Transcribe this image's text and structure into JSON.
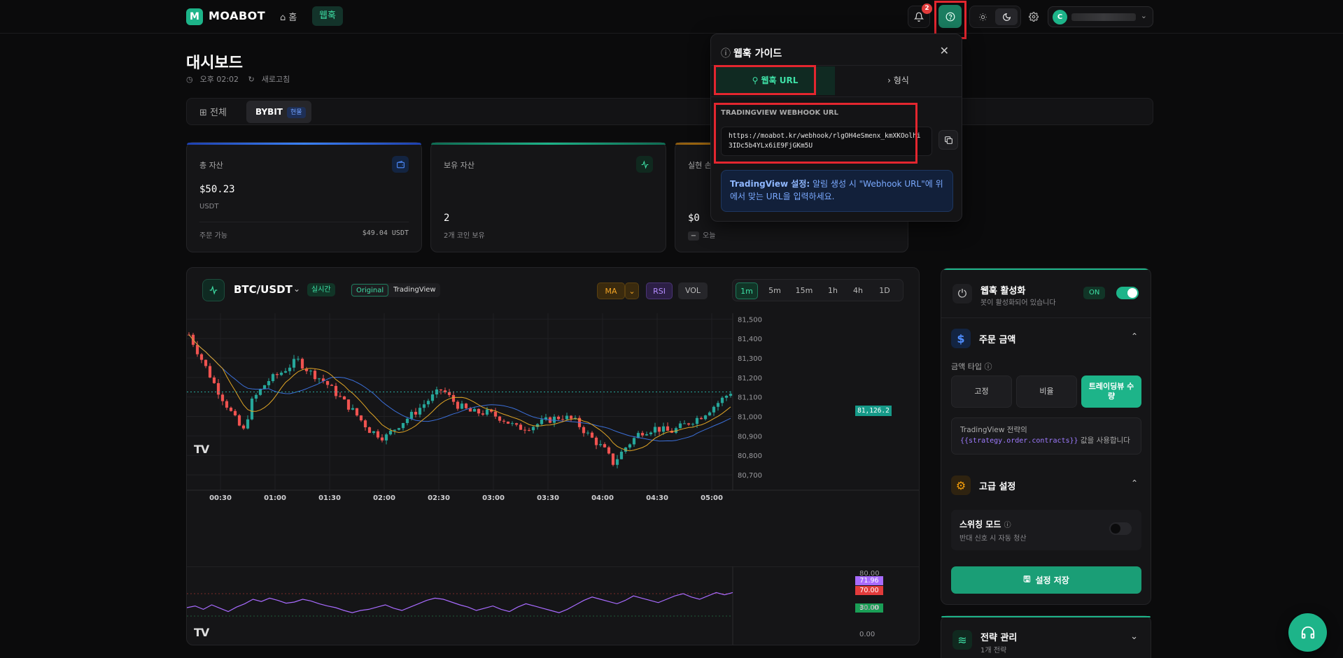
{
  "topbar": {
    "logo_letter": "M",
    "app_name": "MOABOT",
    "nav": [
      {
        "label": "홈",
        "icon": "home-icon"
      },
      {
        "label": "웹훅"
      }
    ],
    "notification_count": "2",
    "avatar_letter": "C"
  },
  "page": {
    "title": "대시보드",
    "time": "오후 02:02",
    "refresh_label": "새로고침"
  },
  "exchange_tabs": {
    "all_label": "전체",
    "bybit_label": "BYBIT",
    "bybit_badge": "현물"
  },
  "cards": [
    {
      "title": "총 자산",
      "value": "$50.23",
      "sub": "USDT",
      "foot_left": "주문 가능",
      "foot_right": "$49.04 USDT",
      "accent": "#3b82f6",
      "icon": "wallet-icon"
    },
    {
      "title": "보유 자산",
      "value": "2",
      "sub": "2개 코인 보유",
      "accent": "#1db489",
      "icon": "activity-icon"
    },
    {
      "title": "실현 손",
      "value": "$0",
      "sub": "오늘",
      "accent": "#f59e0b"
    }
  ],
  "chart": {
    "symbol": "BTC/USDT",
    "live_badge": "실시간",
    "source_options": [
      "Original",
      "TradingView"
    ],
    "indicators": [
      "MA",
      "RSI",
      "VOL"
    ],
    "timeframes": [
      "1m",
      "5m",
      "15m",
      "1h",
      "4h",
      "1D"
    ],
    "active_timeframe": "1m",
    "current_price_label": "81,126.2",
    "rsi_current_label": "71.96",
    "rsi_upper_label": "70.00",
    "rsi_lower_label": "30.00",
    "rsi_axis_labels": [
      "80.00",
      "40.00",
      "0.00"
    ]
  },
  "chart_data": {
    "type": "candlestick",
    "x": [
      "00:30",
      "01:00",
      "01:30",
      "02:00",
      "02:30",
      "03:00",
      "03:30",
      "04:00",
      "04:30",
      "05:00"
    ],
    "y_ticks": [
      "81,500",
      "81,400",
      "81,300",
      "81,200",
      "81,100",
      "81,000",
      "80,900",
      "80,800",
      "80,700"
    ],
    "ylim": [
      80650,
      81530
    ],
    "close_path": [
      [
        0,
        81420
      ],
      [
        8,
        81300
      ],
      [
        18,
        81150
      ],
      [
        28,
        81020
      ],
      [
        36,
        80920
      ],
      [
        42,
        81080
      ],
      [
        52,
        81180
      ],
      [
        62,
        81230
      ],
      [
        72,
        81290
      ],
      [
        80,
        81230
      ],
      [
        90,
        81180
      ],
      [
        100,
        81100
      ],
      [
        110,
        81020
      ],
      [
        120,
        80930
      ],
      [
        130,
        80890
      ],
      [
        140,
        80960
      ],
      [
        150,
        81020
      ],
      [
        160,
        81090
      ],
      [
        168,
        81140
      ],
      [
        178,
        81060
      ],
      [
        188,
        81020
      ],
      [
        198,
        81020
      ],
      [
        208,
        80990
      ],
      [
        218,
        80940
      ],
      [
        228,
        80950
      ],
      [
        238,
        80980
      ],
      [
        248,
        81000
      ],
      [
        256,
        80980
      ],
      [
        266,
        80900
      ],
      [
        276,
        80830
      ],
      [
        282,
        80760
      ],
      [
        290,
        80840
      ],
      [
        300,
        80920
      ],
      [
        310,
        80940
      ],
      [
        320,
        80920
      ],
      [
        330,
        80960
      ],
      [
        340,
        81000
      ],
      [
        350,
        81060
      ],
      [
        360,
        81126
      ]
    ],
    "ma_fast_label": "MA",
    "ma_slow_label": "MA",
    "rsi": {
      "hlines": [
        70,
        30
      ],
      "ylim": [
        0,
        100
      ],
      "values": [
        45,
        48,
        42,
        50,
        44,
        38,
        46,
        52,
        60,
        56,
        62,
        58,
        53,
        55,
        60,
        57,
        52,
        48,
        45,
        40,
        36,
        40,
        42,
        46,
        50,
        44,
        40,
        46,
        52,
        58,
        62,
        60,
        55,
        50,
        46,
        40,
        44,
        48,
        42,
        38,
        46,
        52,
        48,
        44,
        40,
        36,
        42,
        50,
        58,
        64,
        60,
        56,
        52,
        58,
        66,
        62,
        58,
        54,
        60,
        66,
        70,
        64,
        60,
        66,
        72,
        68,
        72
      ]
    }
  },
  "popup": {
    "title": "웹훅 가이드",
    "tab_url": "웹훅 URL",
    "tab_format": "형식",
    "url_label": "TRADINGVIEW WEBHOOK URL",
    "url": "https://moabot.kr/webhook/rlgOH4eSmenx_kmXKOolhi3IDc5b4YLx6iE9FjGKm5U",
    "info_bold": "TradingView 설정:",
    "info_text": " 알림 생성 시 \"Webhook URL\"에 위에서 맞는 URL을 입력하세요."
  },
  "settings": {
    "webhook_title": "웹훅 활성화",
    "webhook_sub": "봇이 활성화되어 있습니다",
    "on_label": "ON",
    "order_amount_title": "주문 금액",
    "amount_type_label": "금액 타입",
    "amount_options": [
      "고정",
      "비율",
      "트레이딩뷰 수량"
    ],
    "info_prefix": "TradingView 전략의",
    "info_code": "{{strategy.order.contracts}}",
    "info_suffix": "값을 사용합니다",
    "advanced_title": "고급 설정",
    "switch_title": "스위칭 모드",
    "switch_sub": "반대 신호 시 자동 청산",
    "save_label": "설정 저장",
    "strategy_title": "전략 관리",
    "strategy_sub": "1개 전략"
  }
}
